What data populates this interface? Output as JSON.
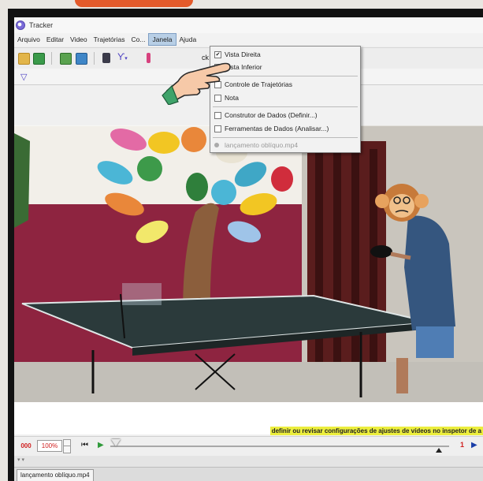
{
  "window": {
    "title": "Tracker"
  },
  "menubar": [
    "Arquivo",
    "Editar",
    "Video",
    "Trajetórias",
    "Co...",
    "Janela",
    "Ajuda"
  ],
  "toolbar": {
    "partial_label": "ck"
  },
  "dropdown": {
    "items": [
      {
        "label": "Vista Direita",
        "checked": true
      },
      {
        "label": "Vista Inferior",
        "checked": false
      },
      {
        "label": "Controle de Trajetórias",
        "checked": false
      },
      {
        "label": "Nota",
        "checked": false
      },
      {
        "label": "Construtor de Dados (Definir...)",
        "checked": false
      },
      {
        "label": "Ferramentas de Dados (Analisar...)",
        "checked": false
      },
      {
        "label": "lançamento oblíquo.mp4",
        "checked": false,
        "disabled": true
      }
    ]
  },
  "status": {
    "message": "definir ou revisar configurações de ajustes de vídeos no inspetor de a"
  },
  "player": {
    "frame": "000",
    "zoom": "100%",
    "end_frame_label": "1"
  },
  "tab": {
    "label": "lançamento oblíquo.mp4"
  },
  "colors": {
    "highlight": "#ecee3d",
    "menu_active": "#b8cfe6",
    "accent": "#e45a2a"
  },
  "icons": [
    "open-folder-icon",
    "save-icon",
    "import-icon",
    "export-icon",
    "clip-icon",
    "track-icon",
    "play-icon",
    "step-start-icon",
    "step-end-icon",
    "pointing-hand-icon",
    "monkey-emoji-icon"
  ]
}
